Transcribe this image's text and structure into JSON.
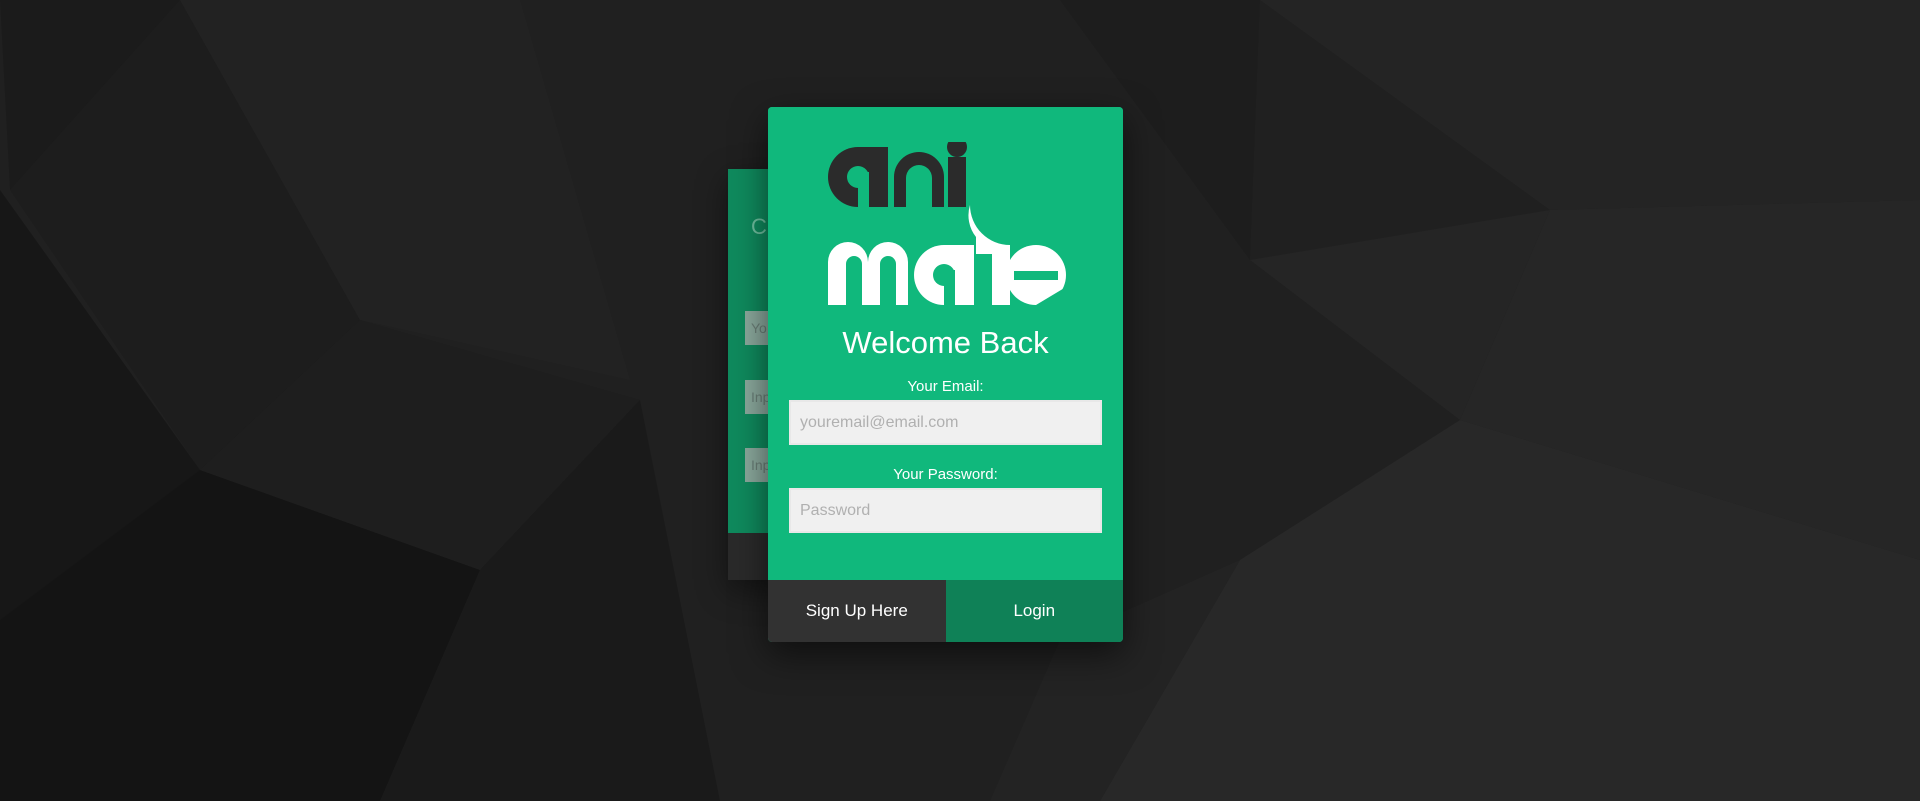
{
  "login_card": {
    "title": "Welcome Back",
    "email_label": "Your Email:",
    "email_placeholder": "youremail@email.com",
    "email_value": "",
    "password_label": "Your Password:",
    "password_placeholder": "Password",
    "password_value": "",
    "signup_button": "Sign Up Here",
    "login_button": "Login"
  },
  "logo": {
    "line1": "ani",
    "line2": "mate",
    "dark_color": "#2b2b2b",
    "light_color": "#ffffff"
  },
  "back_card": {
    "title_fragment": "C",
    "input_fragments": [
      "Yo",
      "Inp",
      "Inp"
    ]
  },
  "colors": {
    "background": "#1f1f1f",
    "card_green": "#10b87c",
    "login_button": "#0f8157",
    "signup_button": "#323232"
  }
}
